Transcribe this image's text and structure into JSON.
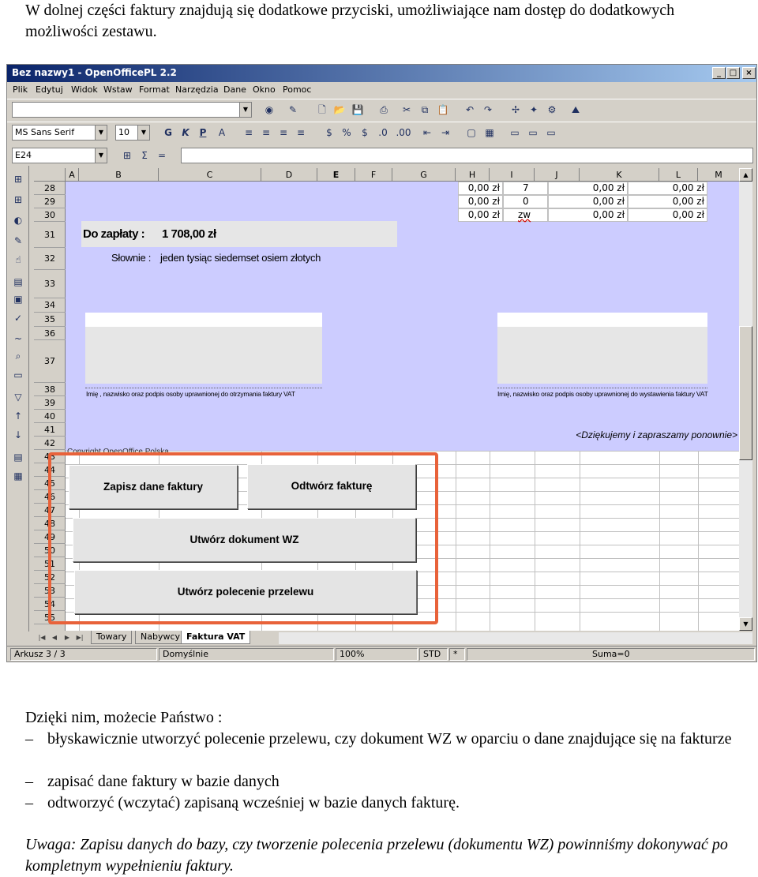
{
  "intro": "W dolnej części faktury znajdują się dodatkowe przyciski, umożliwiające nam dostęp do dodatkowych możliwości zestawu.",
  "window": {
    "title": "Bez nazwy1 - OpenOfficePL 2.2",
    "menu": [
      "Plik",
      "Edytuj",
      "Widok",
      "Wstaw",
      "Format",
      "Narzędzia",
      "Dane",
      "Okno",
      "Pomoc"
    ],
    "font_name": "MS Sans Serif",
    "font_size": "10",
    "cell_ref": "E24",
    "format_buttons": {
      "bold": "G",
      "italic": "K",
      "underline": "P"
    },
    "formula_sigma": "Σ",
    "formula_equals": "="
  },
  "sheet": {
    "columns": [
      "A",
      "B",
      "C",
      "D",
      "E",
      "F",
      "G",
      "H",
      "I",
      "J",
      "K",
      "L",
      "M"
    ],
    "rows": [
      "28",
      "29",
      "30",
      "31",
      "32",
      "33",
      "34",
      "35",
      "36",
      "37",
      "38",
      "39",
      "40",
      "41",
      "42",
      "43",
      "44",
      "45",
      "46",
      "47",
      "48",
      "49",
      "50",
      "51",
      "52",
      "53",
      "54",
      "55"
    ],
    "table_rows": [
      [
        "0,00 zł",
        "7",
        "0,00 zł",
        "0,00 zł"
      ],
      [
        "0,00 zł",
        "0",
        "0,00 zł",
        "0,00 zł"
      ],
      [
        "0,00 zł",
        "zw",
        "0,00 zł",
        "0,00 zł"
      ]
    ],
    "to_pay_label": "Do zapłaty :",
    "to_pay_value": "1 708,00 zł",
    "words_label": "Słownie :",
    "words_value": "jeden tysiąc siedemset osiem złotych",
    "sig_left": "Imię , nazwisko oraz podpis osoby uprawnionej do otrzymania faktury VAT",
    "sig_right": "Imię, nazwisko oraz podpis osoby uprawnionej do wystawienia faktury VAT",
    "thanks": "<Dziękujemy i zapraszamy ponownie>",
    "copyright": "Copyright OpenOffice Polska"
  },
  "buttons": {
    "save": "Zapisz dane faktury",
    "restore": "Odtwórz fakturę",
    "wz": "Utwórz dokument WZ",
    "transfer": "Utwórz polecenie przelewu"
  },
  "tabs": [
    "Towary",
    "Nabywcy",
    "Faktura VAT"
  ],
  "status": {
    "sheet": "Arkusz 3 / 3",
    "style": "Domyślnie",
    "zoom": "100%",
    "mode": "STD",
    "modified": "*",
    "sum": "Suma=0"
  },
  "lead": "Dzięki nim, możecie Państwo :",
  "bullets": [
    "błyskawicznie utworzyć polecenie przelewu, czy dokument WZ w oparciu o dane znajdujące się na fakturze",
    "zapisać dane faktury w bazie danych",
    "odtworzyć (wczytać) zapisaną wcześniej w bazie danych fakturę."
  ],
  "note": "Uwaga: Zapisu danych do bazy, czy tworzenie polecenia przelewu (dokumentu WZ) powinniśmy dokonywać po kompletnym wypełnieniu faktury.",
  "colors": {
    "highlight": "#e8623a",
    "sheet_bg": "#ccccff",
    "title_bar": "#0a246a"
  }
}
